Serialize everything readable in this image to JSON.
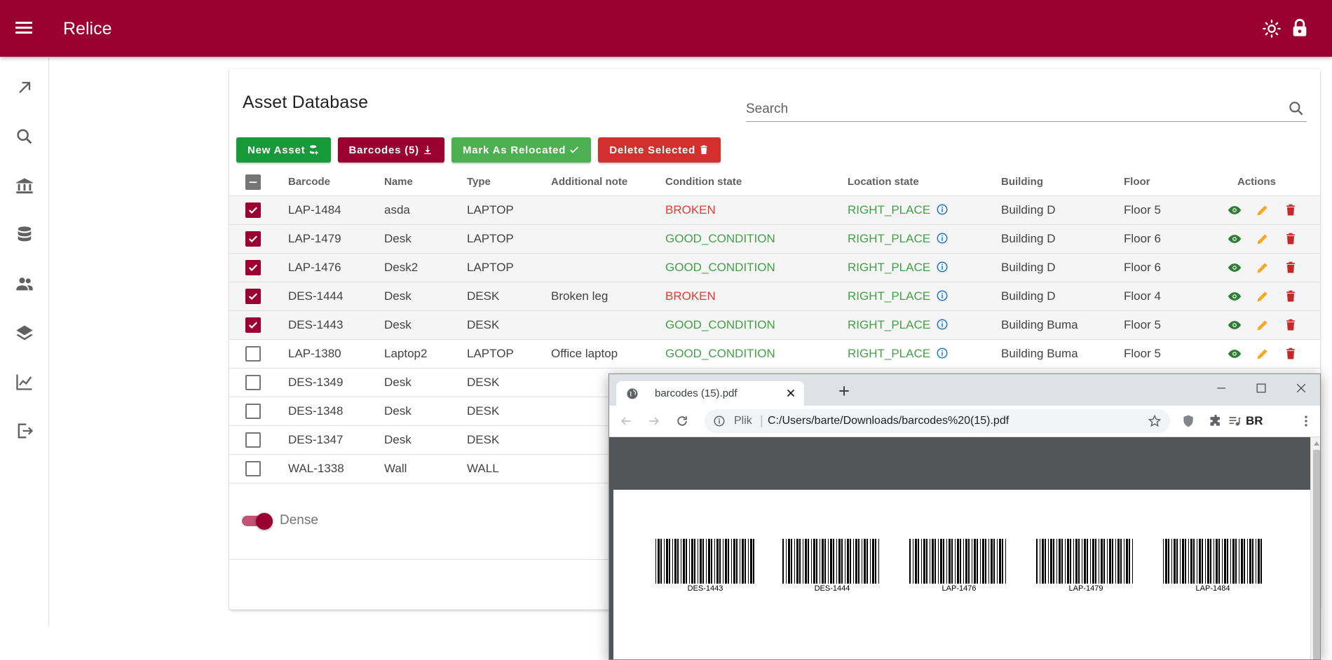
{
  "app": {
    "title": "Relice"
  },
  "page": {
    "title": "Asset Database",
    "search_placeholder": "Search"
  },
  "toolbar": {
    "new_asset": "New Asset",
    "barcodes": "Barcodes (5)",
    "mark_relocated": "Mark As Relocated",
    "delete_selected": "Delete Selected"
  },
  "table": {
    "headers": [
      "Barcode",
      "Name",
      "Type",
      "Additional note",
      "Condition state",
      "Location state",
      "Building",
      "Floor",
      "Actions"
    ],
    "rows": [
      {
        "selected": true,
        "barcode": "LAP-1484",
        "name": "asda",
        "type": "LAPTOP",
        "note": "",
        "condition": "BROKEN",
        "location": "RIGHT_PLACE",
        "building": "Building D",
        "floor": "Floor 5"
      },
      {
        "selected": true,
        "barcode": "LAP-1479",
        "name": "Desk",
        "type": "LAPTOP",
        "note": "",
        "condition": "GOOD_CONDITION",
        "location": "RIGHT_PLACE",
        "building": "Building D",
        "floor": "Floor 6"
      },
      {
        "selected": true,
        "barcode": "LAP-1476",
        "name": "Desk2",
        "type": "LAPTOP",
        "note": "",
        "condition": "GOOD_CONDITION",
        "location": "RIGHT_PLACE",
        "building": "Building D",
        "floor": "Floor 6"
      },
      {
        "selected": true,
        "barcode": "DES-1444",
        "name": "Desk",
        "type": "DESK",
        "note": "Broken leg",
        "condition": "BROKEN",
        "location": "RIGHT_PLACE",
        "building": "Building D",
        "floor": "Floor 4"
      },
      {
        "selected": true,
        "barcode": "DES-1443",
        "name": "Desk",
        "type": "DESK",
        "note": "",
        "condition": "GOOD_CONDITION",
        "location": "RIGHT_PLACE",
        "building": "Building Buma",
        "floor": "Floor 5"
      },
      {
        "selected": false,
        "barcode": "LAP-1380",
        "name": "Laptop2",
        "type": "LAPTOP",
        "note": "Office laptop",
        "condition": "GOOD_CONDITION",
        "location": "RIGHT_PLACE",
        "building": "Building Buma",
        "floor": "Floor 5"
      },
      {
        "selected": false,
        "barcode": "DES-1349",
        "name": "Desk",
        "type": "DESK",
        "note": "",
        "condition": "",
        "location": "",
        "building": "",
        "floor": ""
      },
      {
        "selected": false,
        "barcode": "DES-1348",
        "name": "Desk",
        "type": "DESK",
        "note": "",
        "condition": "",
        "location": "",
        "building": "",
        "floor": ""
      },
      {
        "selected": false,
        "barcode": "DES-1347",
        "name": "Desk",
        "type": "DESK",
        "note": "",
        "condition": "",
        "location": "",
        "building": "",
        "floor": ""
      },
      {
        "selected": false,
        "barcode": "WAL-1338",
        "name": "Wall",
        "type": "WALL",
        "note": "",
        "condition": "",
        "location": "",
        "building": "",
        "floor": ""
      }
    ]
  },
  "dense": {
    "label": "Dense",
    "on": true
  },
  "browser": {
    "tab_title": "barcodes (15).pdf",
    "scheme": "Plik",
    "url": "C:/Users/barte/Downloads/barcodes%20(15).pdf",
    "ext_label": "BR",
    "barcodes": [
      "DES-1443",
      "DES-1444",
      "LAP-1476",
      "LAP-1479",
      "LAP-1484"
    ]
  },
  "colors": {
    "brand": "#9b0032",
    "good": "#43a047",
    "bad": "#e53935",
    "view": "#2e7d32",
    "edit": "#f9a825",
    "delete": "#c62828"
  },
  "sidebar": {
    "icons": [
      "arrow-up-right-icon",
      "search-icon",
      "bank-icon",
      "database-icon",
      "users-icon",
      "layers-icon",
      "chart-icon",
      "logout-icon"
    ]
  }
}
